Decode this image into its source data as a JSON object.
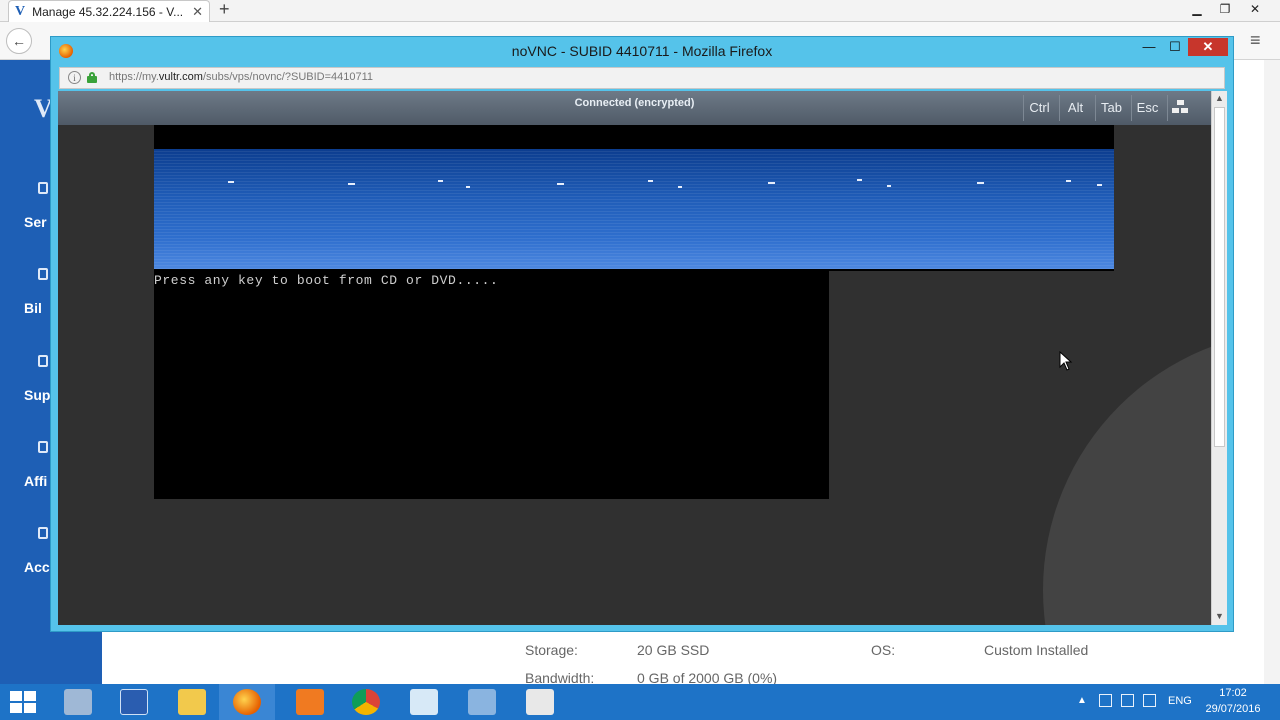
{
  "background_browser": {
    "tab_title": "Manage 45.32.224.156 - V...",
    "tab_logo": "V",
    "sidebar": {
      "items": [
        {
          "label": "Ser",
          "icon": "servers-icon"
        },
        {
          "label": "Bil",
          "icon": "billing-icon"
        },
        {
          "label": "Sup",
          "icon": "support-icon"
        },
        {
          "label": "Affi",
          "icon": "affiliate-icon"
        },
        {
          "label": "Acc",
          "icon": "account-icon"
        }
      ]
    },
    "details": {
      "storage_label": "Storage:",
      "storage_value": "20 GB SSD",
      "os_label": "OS:",
      "os_value": "Custom Installed",
      "bandwidth_label": "Bandwidth:",
      "bandwidth_value": "0 GB of 2000 GB (0%)"
    }
  },
  "firefox": {
    "window_title": "noVNC - SUBID 4410711 - Mozilla Firefox",
    "url_scheme": "https://my.",
    "url_host": "vultr.com",
    "url_path": "/subs/vps/novnc/?SUBID=4410711",
    "controls": {
      "minimize": "—",
      "maximize": "☐",
      "close": "✕"
    }
  },
  "novnc": {
    "status": "Connected (encrypted)",
    "keys": [
      "Ctrl",
      "Alt",
      "Tab",
      "Esc"
    ],
    "console_text": "Press any key to boot from CD or DVD....."
  },
  "taskbar": {
    "apps": [
      "server-manager-icon",
      "powershell-icon",
      "file-explorer-icon",
      "firefox-icon",
      "xampp-icon",
      "chrome-icon",
      "notepad-icon",
      "network-tool-icon",
      "recorder-icon"
    ],
    "language": "ENG",
    "time": "17:02",
    "date": "29/07/2016"
  },
  "colors": {
    "vultr_blue": "#1e5fb5",
    "firefox_frame": "#55c3ea",
    "close_red": "#c7362c",
    "taskbar": "#1e73c7",
    "novnc_bg": "#303030"
  }
}
